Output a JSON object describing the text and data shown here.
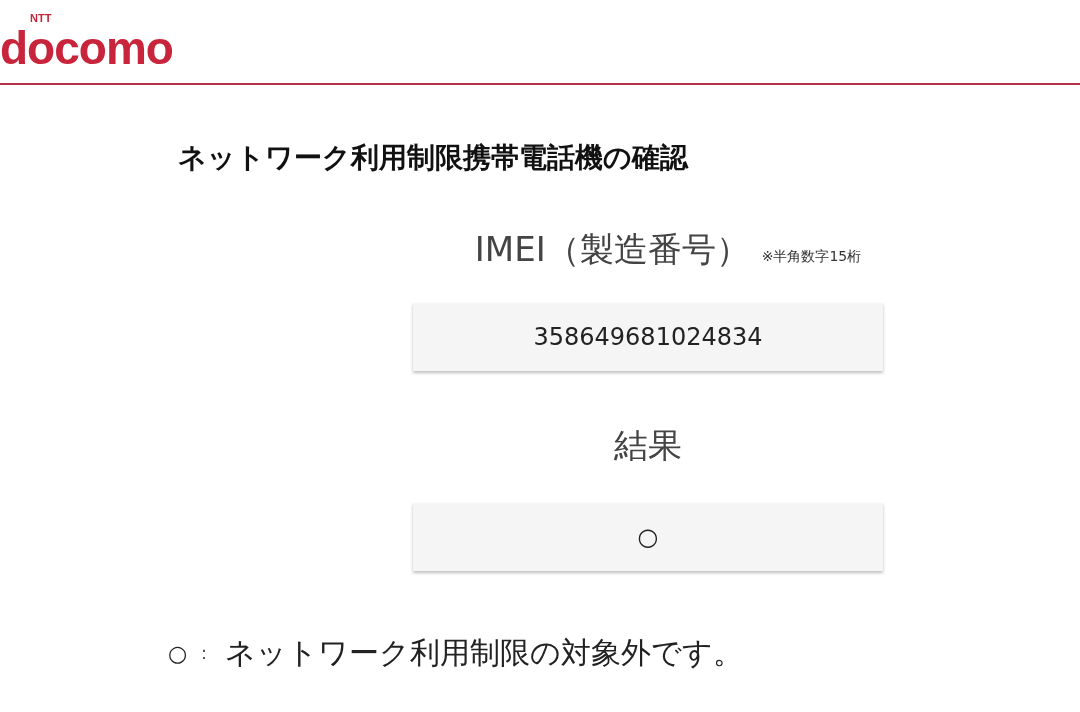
{
  "header": {
    "logo_super": "NTT",
    "logo": "docomo"
  },
  "title": "ネットワーク利用制限携帯電話機の確認",
  "imei": {
    "label": "IMEI（製造番号）",
    "note": "※半角数字15桁",
    "value": "358649681024834"
  },
  "result": {
    "label": "結果",
    "value": "○"
  },
  "legend": {
    "symbol": "○",
    "separator": "：",
    "text": "ネットワーク利用制限の対象外です。"
  }
}
